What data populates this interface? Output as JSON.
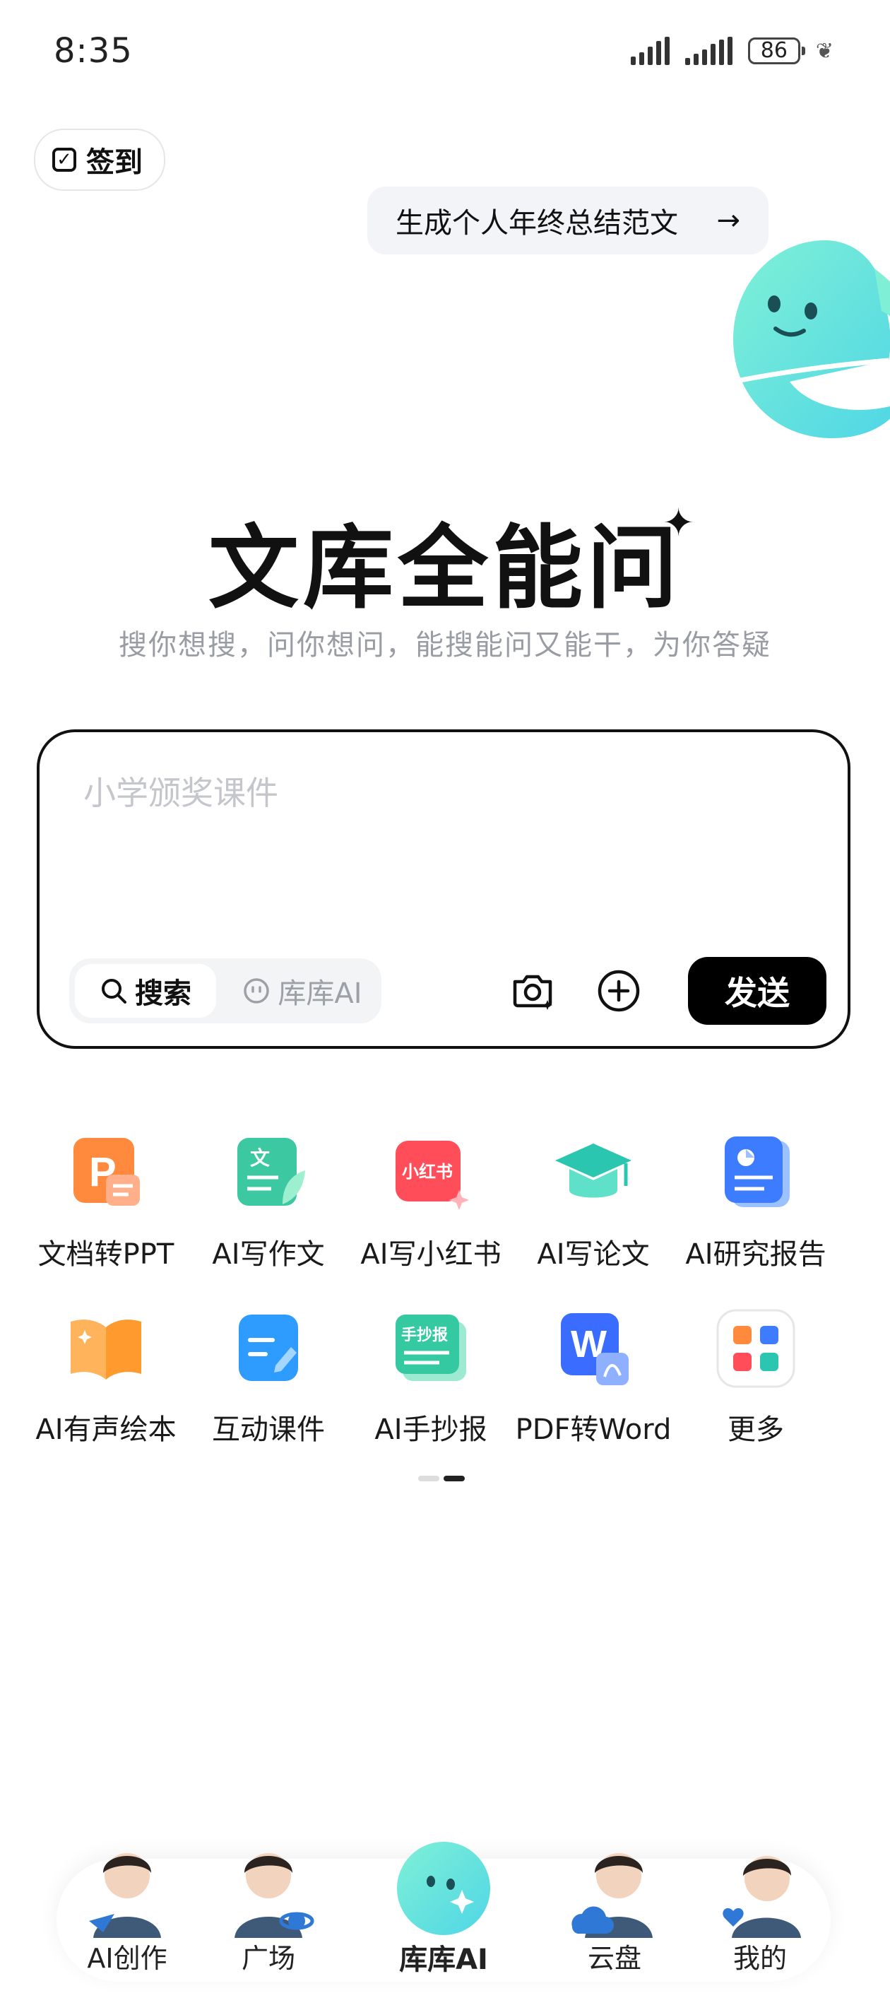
{
  "status_bar": {
    "time": "8:35",
    "battery": "86"
  },
  "checkin": {
    "label": "签到"
  },
  "suggestion": {
    "text": "生成个人年终总结范文",
    "arrow": "→"
  },
  "hero": {
    "title": "文库全能问",
    "subtitle": "搜你想搜，问你想问，能搜能问又能干，为你答疑"
  },
  "composer": {
    "placeholder": "小学颁奖课件",
    "mode_search": "搜索",
    "mode_ai": "库库AI",
    "send_label": "发送"
  },
  "tools": [
    {
      "label": "文档转PPT",
      "icon": "ppt-icon",
      "color": "#ff8a3d"
    },
    {
      "label": "AI写作文",
      "icon": "essay-icon",
      "color": "#3cc8a0"
    },
    {
      "label": "AI写小红书",
      "icon": "xiaohongshu-icon",
      "color": "#ff4d5a",
      "badge": "小红书"
    },
    {
      "label": "AI写论文",
      "icon": "graduation-cap-icon",
      "color": "#2bc6b0"
    },
    {
      "label": "AI研究报告",
      "icon": "report-icon",
      "color": "#3d7bff"
    },
    {
      "label": "AI有声绘本",
      "icon": "book-icon",
      "color": "#ff9a2e"
    },
    {
      "label": "互动课件",
      "icon": "courseware-icon",
      "color": "#2e9bff"
    },
    {
      "label": "AI手抄报",
      "icon": "handcopy-icon",
      "color": "#35c9a2",
      "badge": "手抄报"
    },
    {
      "label": "PDF转Word",
      "icon": "pdf-word-icon",
      "color": "#3a6cff",
      "badge": "W"
    },
    {
      "label": "更多",
      "icon": "more-apps-icon",
      "color": "#f4f4f4"
    }
  ],
  "nav": [
    {
      "label": "AI创作",
      "icon": "avatar-creation-icon"
    },
    {
      "label": "广场",
      "icon": "avatar-plaza-icon"
    },
    {
      "label": "库库AI",
      "icon": "kuku-mascot-icon",
      "active": true
    },
    {
      "label": "云盘",
      "icon": "avatar-cloud-icon"
    },
    {
      "label": "我的",
      "icon": "avatar-mine-icon"
    }
  ]
}
